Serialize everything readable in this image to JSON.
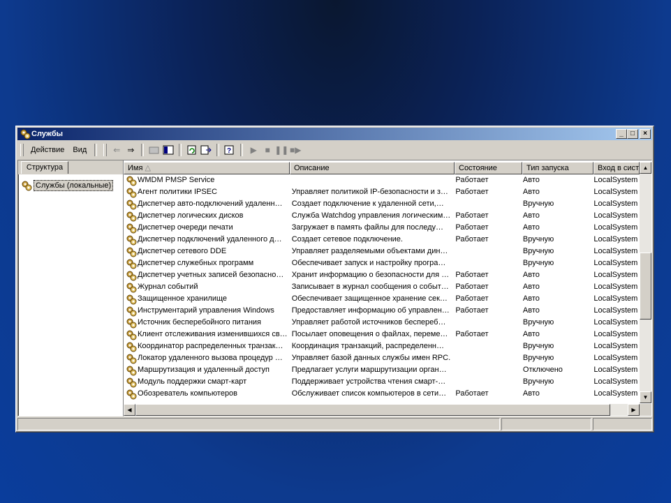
{
  "window": {
    "title": "Службы"
  },
  "menu": {
    "action": "Действие",
    "view": "Вид"
  },
  "toolbar_icons": [
    "back-icon",
    "forward-icon",
    "up-folder-icon",
    "show-hide-tree-icon",
    "refresh-icon",
    "export-list-icon",
    "help-icon",
    "play-icon",
    "stop-icon",
    "pause-icon",
    "restart-icon"
  ],
  "left": {
    "tab": "Структура",
    "tree_root": "Службы (локальные)"
  },
  "columns": {
    "name": "Имя",
    "desc": "Описание",
    "state": "Состояние",
    "startup": "Тип запуска",
    "logon": "Вход в систе"
  },
  "rows": [
    {
      "name": "WMDM PMSP Service",
      "desc": "",
      "state": "Работает",
      "startup": "Авто",
      "logon": "LocalSystem"
    },
    {
      "name": "Агент политики IPSEC",
      "desc": "Управляет политикой IP-безопасности и з…",
      "state": "Работает",
      "startup": "Авто",
      "logon": "LocalSystem"
    },
    {
      "name": "Диспетчер авто-подключений удаленн…",
      "desc": "Создает подключение к удаленной сети,…",
      "state": "",
      "startup": "Вручную",
      "logon": "LocalSystem"
    },
    {
      "name": "Диспетчер логических дисков",
      "desc": "Служба Watchdog управления логическим…",
      "state": "Работает",
      "startup": "Авто",
      "logon": "LocalSystem"
    },
    {
      "name": "Диспетчер очереди печати",
      "desc": "Загружает в память файлы для последу…",
      "state": "Работает",
      "startup": "Авто",
      "logon": "LocalSystem"
    },
    {
      "name": "Диспетчер подключений удаленного д…",
      "desc": "Создает сетевое подключение.",
      "state": "Работает",
      "startup": "Вручную",
      "logon": "LocalSystem"
    },
    {
      "name": "Диспетчер сетевого DDE",
      "desc": "Управляет разделяемыми объектами дин…",
      "state": "",
      "startup": "Вручную",
      "logon": "LocalSystem"
    },
    {
      "name": "Диспетчер служебных программ",
      "desc": "Обеспечивает запуск и настройку програ…",
      "state": "",
      "startup": "Вручную",
      "logon": "LocalSystem"
    },
    {
      "name": "Диспетчер учетных записей безопасно…",
      "desc": "Хранит информацию о безопасности для …",
      "state": "Работает",
      "startup": "Авто",
      "logon": "LocalSystem"
    },
    {
      "name": "Журнал событий",
      "desc": "Записывает в журнал сообщения о событ…",
      "state": "Работает",
      "startup": "Авто",
      "logon": "LocalSystem"
    },
    {
      "name": "Защищенное хранилище",
      "desc": "Обеспечивает защищенное хранение сек…",
      "state": "Работает",
      "startup": "Авто",
      "logon": "LocalSystem"
    },
    {
      "name": "Инструментарий управления Windows",
      "desc": "Предоставляет информацию об управлен…",
      "state": "Работает",
      "startup": "Авто",
      "logon": "LocalSystem"
    },
    {
      "name": "Источник бесперебойного питания",
      "desc": "Управляет работой источников беспереб…",
      "state": "",
      "startup": "Вручную",
      "logon": "LocalSystem"
    },
    {
      "name": "Клиент отслеживания изменившихся св…",
      "desc": "Посылает оповещения о файлах, переме…",
      "state": "Работает",
      "startup": "Авто",
      "logon": "LocalSystem"
    },
    {
      "name": "Координатор распределенных транзак…",
      "desc": "Координация транзакций, распределенн…",
      "state": "",
      "startup": "Вручную",
      "logon": "LocalSystem"
    },
    {
      "name": "Локатор удаленного вызова процедур …",
      "desc": "Управляет базой данных службы имен RPC.",
      "state": "",
      "startup": "Вручную",
      "logon": "LocalSystem"
    },
    {
      "name": "Маршрутизация и удаленный доступ",
      "desc": "Предлагает услуги маршрутизации орган…",
      "state": "",
      "startup": "Отключено",
      "logon": "LocalSystem"
    },
    {
      "name": "Модуль поддержки смарт-карт",
      "desc": "Поддерживает устройства чтения смарт-…",
      "state": "",
      "startup": "Вручную",
      "logon": "LocalSystem"
    },
    {
      "name": "Обозреватель компьютеров",
      "desc": "Обслуживает список компьютеров в сети…",
      "state": "Работает",
      "startup": "Авто",
      "logon": "LocalSystem"
    }
  ]
}
